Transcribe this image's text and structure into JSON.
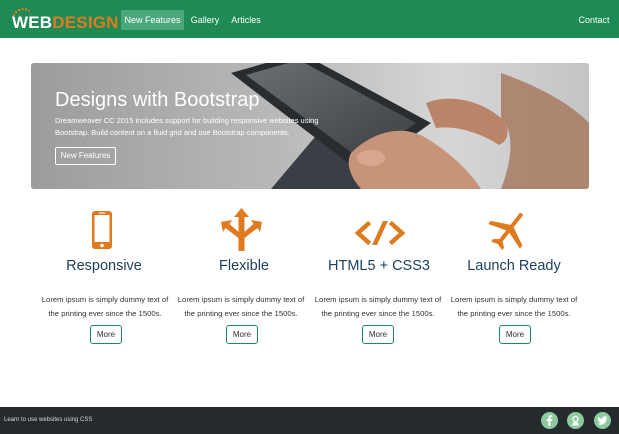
{
  "navbar": {
    "logo_web": "WEB",
    "logo_design": "DESIGN",
    "items": [
      {
        "label": "New Features",
        "active": true
      },
      {
        "label": "Gallery",
        "active": false
      },
      {
        "label": "Articles",
        "active": false
      }
    ],
    "contact_label": "Contact",
    "background": "#1e8a55",
    "active_background": "#4ba77a"
  },
  "hero": {
    "title": "Designs with Bootstrap",
    "text": "Dreamweaver CC 2015 includes support for building responsive websites using Bootstrap. Build content on a fluid grid and use Bootstrap components.",
    "button_label": "New Features"
  },
  "features": [
    {
      "icon": "mobile-phone-icon",
      "title": "Responsive",
      "text": "Lorem ipsum is simply dummy text of the printing ever since the 1500s.",
      "button": "More"
    },
    {
      "icon": "split-arrows-icon",
      "title": "Flexible",
      "text": "Lorem ipsum is simply dummy text of the printing ever since the 1500s.",
      "button": "More"
    },
    {
      "icon": "code-icon",
      "title": "HTML5 + CSS3",
      "text": "Lorem ipsum is simply dummy text of the printing ever since the 1500s.",
      "button": "More"
    },
    {
      "icon": "airplane-icon",
      "title": "Launch Ready",
      "text": "Lorem ipsum is simply dummy text of the printing ever since the 1500s.",
      "button": "More"
    }
  ],
  "footer": {
    "text": "Learn to use websites using CSS",
    "social_icons": [
      "facebook-icon",
      "google-plus-icon",
      "twitter-icon"
    ],
    "background": "#252a2d"
  },
  "colors": {
    "accent_orange": "#e07a1f",
    "title_blue": "#1c3f5e",
    "brand_green": "#1e8a55"
  }
}
